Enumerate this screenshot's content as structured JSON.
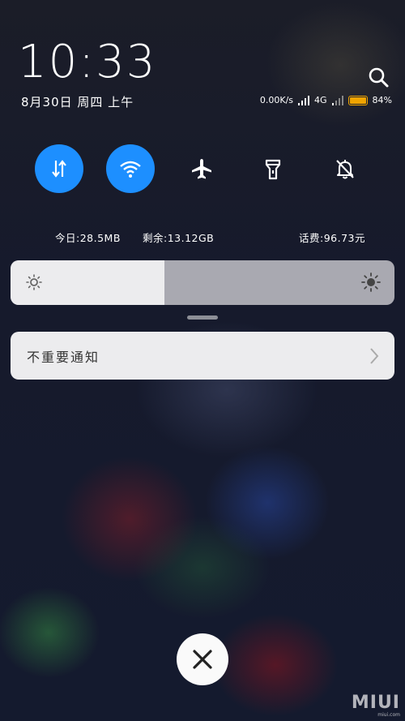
{
  "lockscreen": {
    "time": "10:33",
    "date": "8月30日 周四 上午"
  },
  "status_bar": {
    "network_speed": "0.00K/s",
    "network_type": "4G",
    "battery_percent": "84%",
    "battery_color": "#f0a400"
  },
  "toggles": [
    {
      "name": "mobile-data",
      "icon": "data-arrows-icon",
      "active": true
    },
    {
      "name": "wifi",
      "icon": "wifi-icon",
      "active": true
    },
    {
      "name": "airplane-mode",
      "icon": "airplane-icon",
      "active": false
    },
    {
      "name": "flashlight",
      "icon": "flashlight-icon",
      "active": false
    },
    {
      "name": "mute",
      "icon": "bell-off-icon",
      "active": false
    }
  ],
  "usage": {
    "today": "今日:28.5MB",
    "remaining": "剩余:13.12GB",
    "balance": "话费:96.73元"
  },
  "brightness": {
    "level": 0.4
  },
  "notification": {
    "label": "不重要通知"
  },
  "watermark": {
    "logo": "MIUI",
    "url": "miui.com"
  },
  "colors": {
    "accent": "#1d8fff"
  }
}
